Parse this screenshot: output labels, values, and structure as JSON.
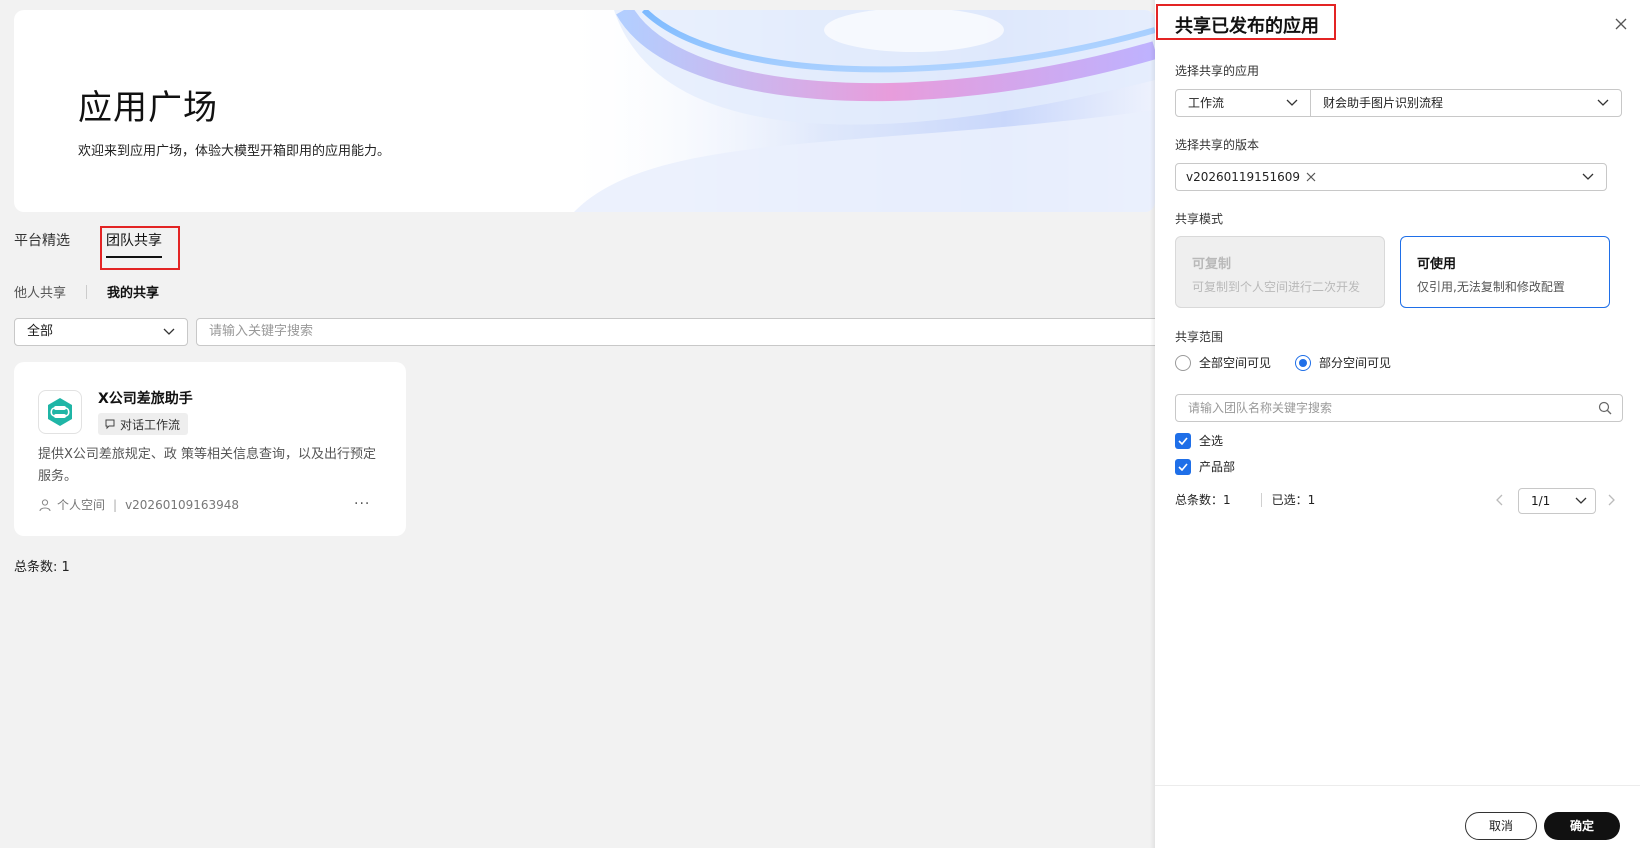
{
  "hero": {
    "title": "应用广场",
    "subtitle": "欢迎来到应用广场，体验大模型开箱即用的应用能力。"
  },
  "tabs": [
    {
      "label": "平台精选",
      "active": false
    },
    {
      "label": "团队共享",
      "active": true
    }
  ],
  "subtabs": [
    {
      "label": "他人共享",
      "active": false
    },
    {
      "label": "我的共享",
      "active": true
    }
  ],
  "filter": {
    "value": "全部"
  },
  "search": {
    "placeholder": "请输入关键字搜索"
  },
  "card": {
    "name": "X公司差旅助手",
    "tag": "对话工作流",
    "description": "提供X公司差旅规定、政 策等相关信息查询，以及出行预定服务。",
    "space": "个人空间",
    "version": "v20260109163948",
    "more": "..."
  },
  "total_main": "总条数: 1",
  "drawer": {
    "title": "共享已发布的应用",
    "app_label": "选择共享的应用",
    "app_type": "工作流",
    "app_name": "财会助手图片识别流程",
    "version_label": "选择共享的版本",
    "version_chip": "v20260119151609",
    "mode_label": "共享模式",
    "mode_copy_title": "可复制",
    "mode_copy_desc": "可复制到个人空间进行二次开发",
    "mode_use_title": "可使用",
    "mode_use_desc": "仅引用,无法复制和修改配置",
    "scope_label": "共享范围",
    "scope_all": "全部空间可见",
    "scope_partial": "部分空间可见",
    "team_search_placeholder": "请输入团队名称关键字搜索",
    "select_all": "全选",
    "team_item": "产品部",
    "total": "总条数：1",
    "selected": "已选：1",
    "page": "1/1",
    "cancel": "取消",
    "confirm": "确定"
  },
  "colors": {
    "accent": "#1f6fe8",
    "highlight_box": "#e32424",
    "primary_button": "#111111",
    "logo_teal": "#1fb5a6"
  }
}
